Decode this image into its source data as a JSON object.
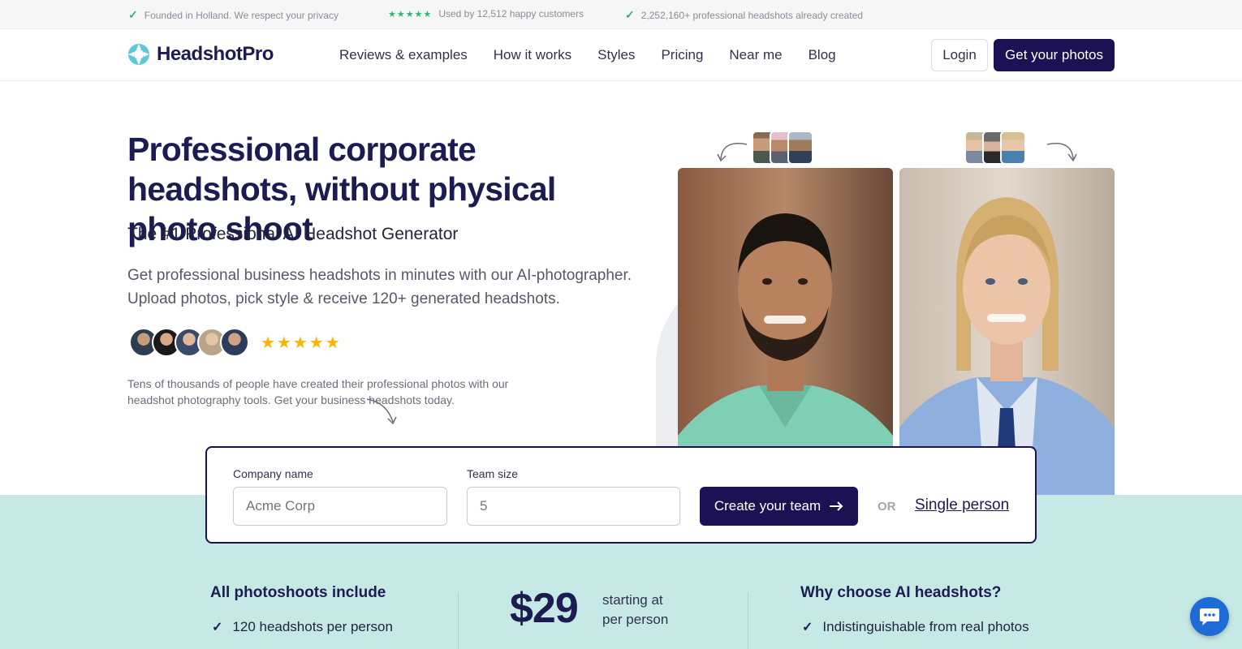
{
  "topbar": {
    "privacy": "Founded in Holland. We respect your privacy",
    "customers": "Used by 12,512 happy customers",
    "created": "2,252,160+ professional headshots already created",
    "stars": "★★★★★"
  },
  "nav": {
    "brand": "HeadshotPro",
    "links": [
      "Reviews & examples",
      "How it works",
      "Styles",
      "Pricing",
      "Near me",
      "Blog"
    ],
    "login": "Login",
    "cta": "Get your photos"
  },
  "hero": {
    "title": "Professional corporate headshots, without physical photo shoot",
    "subtitle": "The #1 Professional AI Headshot Generator",
    "description": "Get professional business headshots in minutes with our AI-photographer. Upload photos, pick style & receive 120+ generated headshots.",
    "rating_stars": "★★★★★",
    "social_proof": "Tens of thousands of people have created their professional photos with our headshot photography tools. Get your business headshots today."
  },
  "form": {
    "company_label": "Company name",
    "company_placeholder": "Acme Corp",
    "team_label": "Team size",
    "team_placeholder": "5",
    "create_button": "Create your team",
    "or": "OR",
    "single_link": "Single person"
  },
  "features": {
    "left_title": "All photoshoots include",
    "left_item": "120 headshots per person",
    "price": "$29",
    "price_note_line1": "starting at",
    "price_note_line2": "per person",
    "right_title": "Why choose AI headshots?",
    "right_item": "Indistinguishable from real photos"
  },
  "colors": {
    "brand_navy": "#1c1152",
    "teal_bg": "#c6e9e6",
    "check_green": "#2fb574",
    "star_yellow": "#f2b705",
    "chat_blue": "#1e6bd6"
  }
}
